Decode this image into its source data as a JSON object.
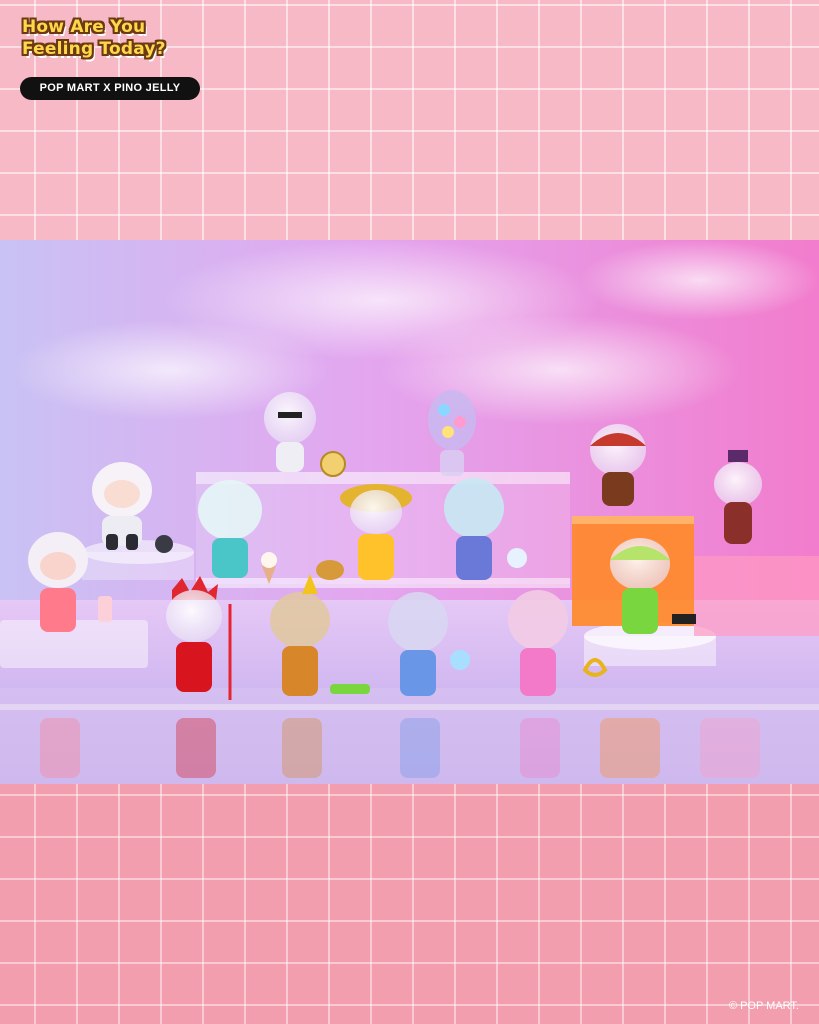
{
  "header": {
    "title_line1": "How Are You",
    "title_line2": "Feeling Today?",
    "collab_badge": "POP MART X PINO JELLY"
  },
  "photo": {
    "description_alt": "Product photo of the figure series"
  },
  "footer": {
    "copyright": "© POP MART."
  },
  "colors": {
    "top_band": "#f8b9c6",
    "bottom_band": "#f29eaf",
    "title_fill": "#ffd84a",
    "title_outline": "#6b3a14",
    "badge_bg": "#111111"
  }
}
